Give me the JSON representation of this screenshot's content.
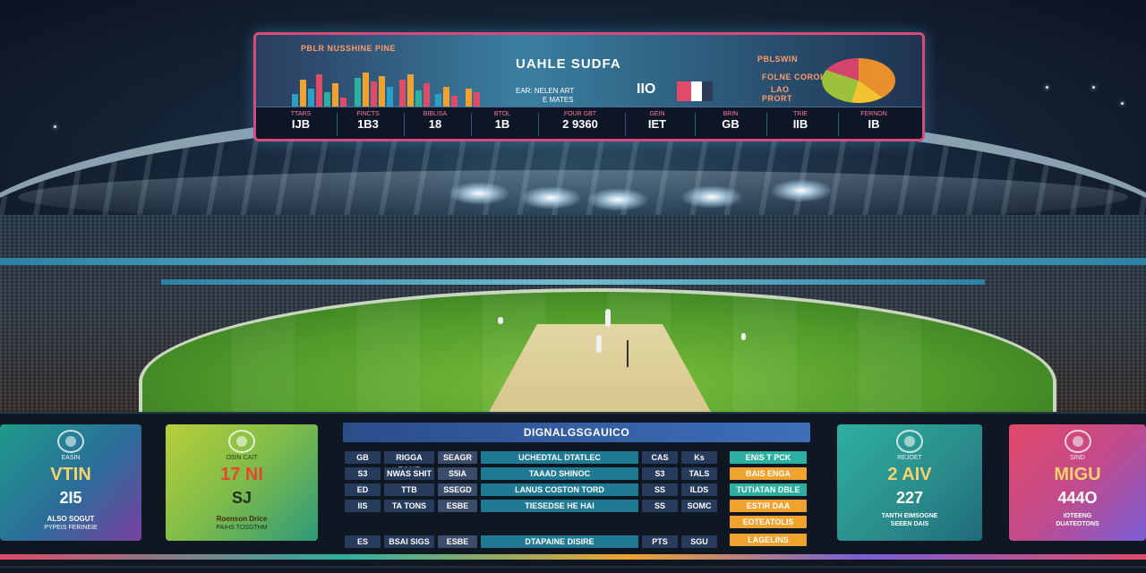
{
  "colors": {
    "accent_pink": "#d94a7a",
    "accent_teal": "#2db0a0",
    "accent_orange": "#f0a22e",
    "header_blue": "#3e6fba",
    "field_green": "#4f9a2a"
  },
  "top_board": {
    "small_left": "PBLR NUSSHINE PINE",
    "title": "UAHLE SUDFA",
    "small_right_1": "PBLSWIN",
    "small_right_2": "FOLNE COROK",
    "small_right_3": "LAO",
    "small_right_4": "PRORT",
    "mid_label": "EAR: NELEN ART",
    "mid_label_2": "E MATES",
    "mid_big": "IIO",
    "cells": [
      {
        "label": "TTARS",
        "value": "IJB"
      },
      {
        "label": "FINCTS",
        "value": "1B3"
      },
      {
        "label": "BIBLISA",
        "value": "18"
      },
      {
        "label": "BTOL",
        "value": "1B"
      },
      {
        "label": "FOUR GBT",
        "value": "2 9360"
      },
      {
        "label": "GEIN",
        "value": "IET"
      },
      {
        "label": "BRIN",
        "value": "GB"
      },
      {
        "label": "TRIE",
        "value": "IIB"
      },
      {
        "label": "FERNON",
        "value": "IB"
      }
    ]
  },
  "cards": [
    {
      "sub": "EASIN",
      "name": "VTIN",
      "score": "2I5",
      "foot": "ALSO SOGUT",
      "foot2": "PYPEIS FERINEIE"
    },
    {
      "sub": "OSIN CAIT",
      "name": "17 NI",
      "score": "SJ",
      "foot": "Roenson Drice",
      "foot2": "PAIHS TOSGTHM"
    },
    {
      "sub": "REJOET",
      "name": "2 AIV",
      "score": "227",
      "foot": "TANTH EIMSOGNE",
      "foot2": "SEEEN DAIS"
    },
    {
      "sub": "SIND",
      "name": "MIGU",
      "score": "444O",
      "foot": "IOTEENG",
      "foot2": "DUATEOTONS"
    }
  ],
  "table": {
    "title": "DIGNALGSGAUICO",
    "rows": [
      [
        "GB",
        "RIGGA FONE",
        "SEAGR",
        "UCHEDTAL DTATLEC",
        "CAS",
        "Ks"
      ],
      [
        "S3",
        "NWAS SHIT",
        "S5IA",
        "TAAAD SHINOC",
        "S3",
        "TALS"
      ],
      [
        "ED",
        "TTB",
        "SSEGD",
        "LANUS COSTON TORD",
        "SS",
        "ILDS"
      ],
      [
        "IIS",
        "TA TONS",
        "ESBE",
        "TIESEDSE HE HAI",
        "SS",
        "SOMC"
      ],
      [
        "ES",
        "BSAI SIGS",
        "ESBE",
        "DTAPAINE DISIRE",
        "PTS",
        "SGU"
      ]
    ],
    "right_column": [
      "ENIS T PCK",
      "BAIS ENGA",
      "TUTIATAN DBLE",
      "ESTIR DAA",
      "EOTEATOLIS",
      "LAGELINS"
    ]
  }
}
